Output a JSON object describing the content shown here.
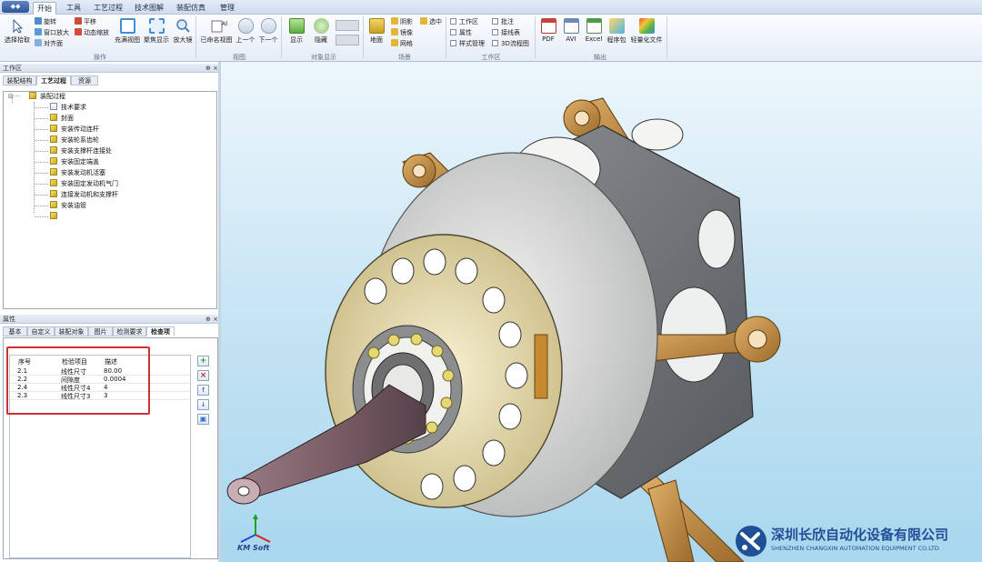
{
  "menu": {
    "app_button": "",
    "tabs": [
      "开始",
      "工具",
      "工艺过程",
      "技术图解",
      "装配仿真",
      "管理"
    ],
    "active_tab": "开始"
  },
  "ribbon": {
    "operate": {
      "label": "操作",
      "select_pick": "选择拾取",
      "rotate": "旋转",
      "pan": "平移",
      "window_zoom": "窗口放大",
      "dynamic_zoom": "动态缩放",
      "align_view": "对齐面",
      "fit_view": "充满视图",
      "fit_display": "聚焦显示",
      "magnifier": "放大镜"
    },
    "view": {
      "label": "视图",
      "named_view": "已命名视图",
      "previous": "上一个",
      "next": "下一个"
    },
    "object_display": {
      "label": "对象显示",
      "show": "显示",
      "hide": "隐藏"
    },
    "scene": {
      "label": "场景",
      "floor": "地面",
      "shadow": "阴影",
      "reflection": "镜像",
      "grid": "网格",
      "select": "选中"
    },
    "workspace": {
      "label": "工作区",
      "workarea": "工作区",
      "property": "属性",
      "style_manager": "样式管理",
      "annotation": "批注",
      "link_table": "接线表",
      "3d_process": "3D流程图"
    },
    "output": {
      "label": "输出",
      "pdf": "PDF",
      "avi": "AVI",
      "excel": "Excel",
      "program": "程序包",
      "lightweight": "轻量化文件"
    }
  },
  "workspace_panel": {
    "title": "工作区",
    "pin": "⊕ ×",
    "tabs": [
      "装配结构",
      "工艺过程",
      "资源"
    ],
    "active_tab": "工艺过程",
    "tree": {
      "root": "装配过程",
      "items": [
        "技术要求",
        "封面",
        "安装传动连杆",
        "安装轮系齿轮",
        "安装支撑杆连接处",
        "安装固定端盖",
        "安装发动机活塞",
        "安装固定发动机气门",
        "连接发动机和支撑杆",
        "安装油管",
        ""
      ]
    }
  },
  "properties_panel": {
    "title": "属性",
    "pin": "⊕ ×",
    "tabs": [
      "基本",
      "自定义",
      "装配对象",
      "图片",
      "检测要求",
      "检查项"
    ],
    "active_tab": "检查项",
    "grid": {
      "headers": [
        "序号",
        "检验项目",
        "描述"
      ],
      "rows": [
        [
          "2.1",
          "线性尺寸",
          "80.00"
        ],
        [
          "2.2",
          "间隙度",
          "0.0004"
        ],
        [
          "2.4",
          "线性尺寸4",
          "4"
        ],
        [
          "2.3",
          "线性尺寸3",
          "3"
        ]
      ]
    },
    "side_buttons": [
      "+",
      "×",
      "↑",
      "↓",
      "▣"
    ]
  },
  "viewport": {
    "logo_text": "KM Soft"
  },
  "watermark": {
    "company_cn": "深圳长欣自动化设备有限公司",
    "company_en": "SHENZHEN CHANGXIN AUTOMATION EQUIPMENT CO.LTD"
  },
  "colors": {
    "ribbon_blue": "#dbe6f4",
    "selection_red": "#d0302f",
    "viewport_top": "#edf6fc",
    "viewport_bottom": "#a9d7ee",
    "bronze_part": "#c68a3e",
    "housing_gray": "#6e7174"
  }
}
